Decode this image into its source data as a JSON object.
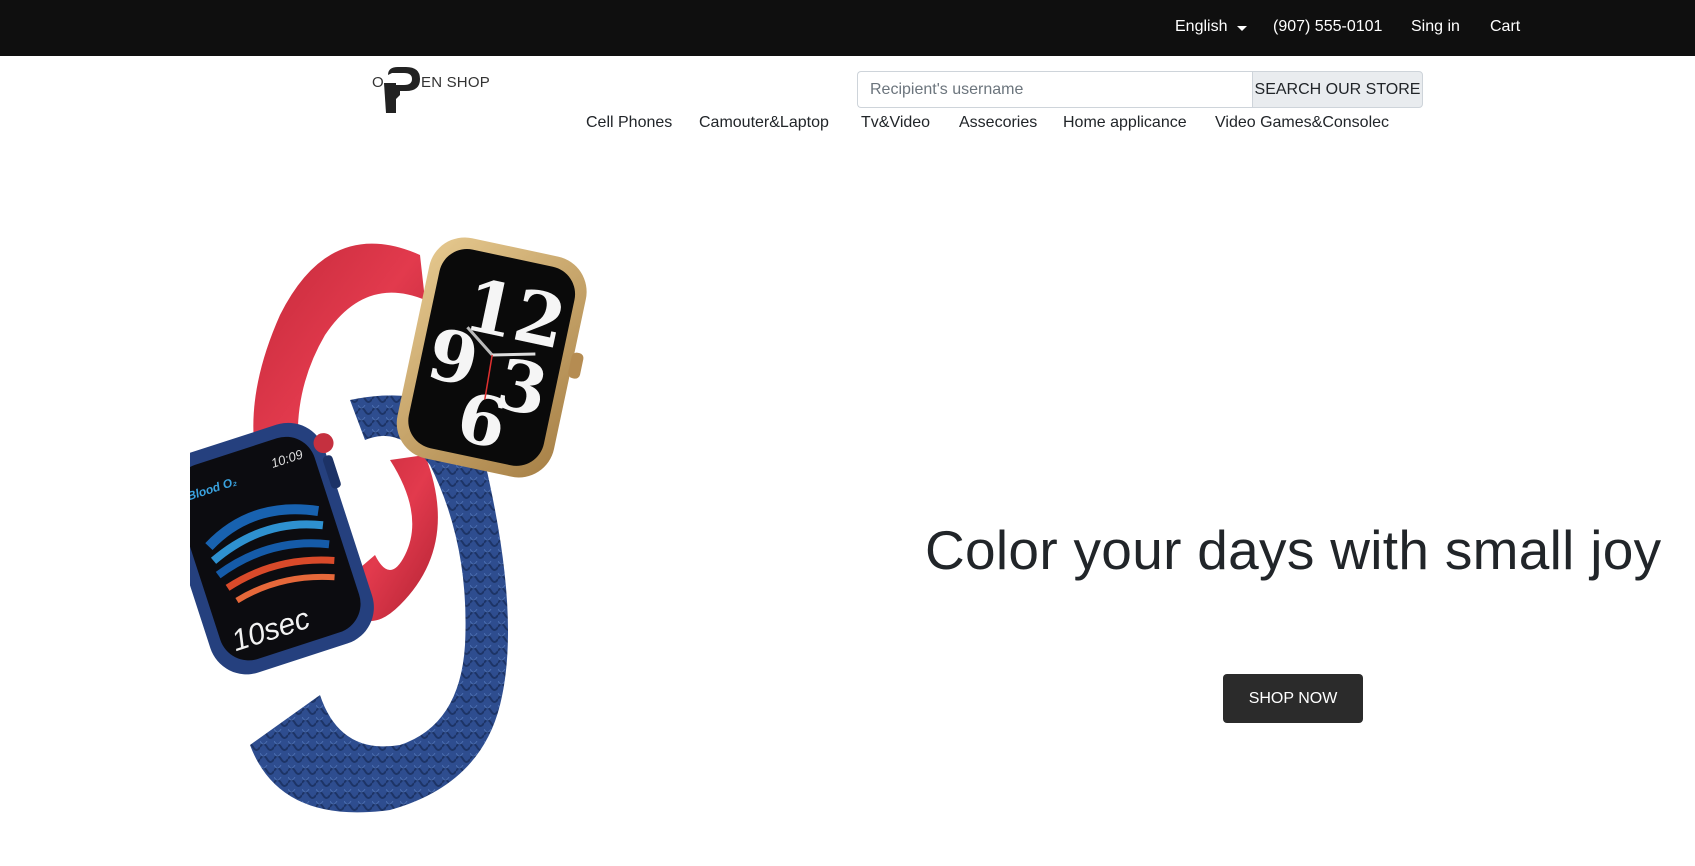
{
  "topbar": {
    "language": "English",
    "phone": "(907) 555-0101",
    "signin": "Sing in",
    "cart": "Cart"
  },
  "logo": {
    "first_letter": "O",
    "rest": "EN SHOP"
  },
  "search": {
    "placeholder": "Recipient's username",
    "button_label": "SEARCH OUR STORE"
  },
  "nav": {
    "items": [
      "Cell Phones",
      "Camouter&Laptop",
      "Tv&Video",
      "Assecories",
      "Home applicance",
      "Video Games&Consolec"
    ]
  },
  "hero": {
    "headline": "Color your days with small joy",
    "cta_label": "SHOP NOW",
    "watch_texts": {
      "time": "10:09",
      "metric": "Blood O₂",
      "duration": "10sec"
    },
    "colors": {
      "band_red": "#d93347",
      "band_blue": "#2e4d8f",
      "case_blue": "#25407e",
      "case_gold": "#c9a46a"
    }
  }
}
